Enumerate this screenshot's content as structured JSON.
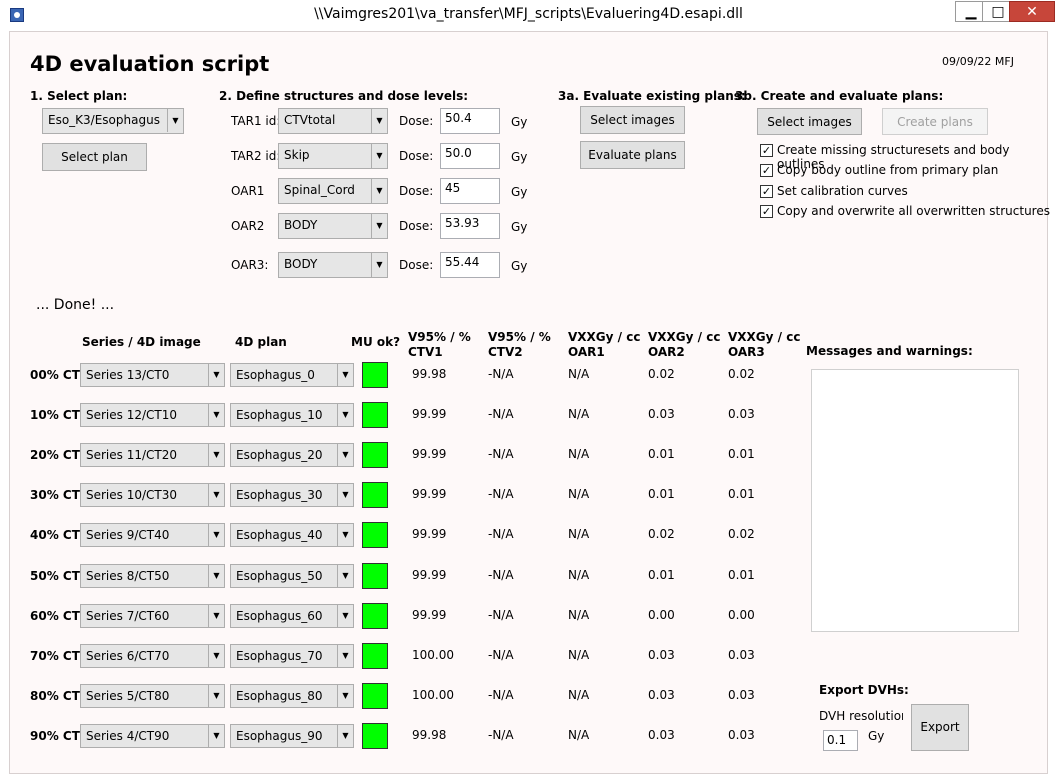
{
  "window": {
    "title": "\\\\Vaimgres201\\va_transfer\\MFJ_scripts\\Evaluering4D.esapi.dll",
    "minimize": "▁",
    "maximize": "□",
    "close": "✕"
  },
  "header": {
    "title": "4D evaluation script",
    "version_date": "09/09/22 MFJ"
  },
  "step1": {
    "heading": "1. Select plan:",
    "plan_value": "Eso_K3/Esophagus",
    "select_button": "Select plan"
  },
  "step2": {
    "heading": "2. Define structures and dose levels:",
    "dose_label": "Dose:",
    "unit": "Gy",
    "rows": [
      {
        "label": "TAR1 id:",
        "structure": "CTVtotal",
        "dose": "50.4"
      },
      {
        "label": "TAR2 id:",
        "structure": "Skip",
        "dose": "50.0"
      },
      {
        "label": "OAR1",
        "structure": "Spinal_Cord",
        "dose": "45"
      },
      {
        "label": "OAR2",
        "structure": "BODY",
        "dose": "53.93"
      },
      {
        "label": "OAR3:",
        "structure": "BODY",
        "dose": "55.44"
      }
    ]
  },
  "step3a": {
    "heading": "3a. Evaluate existing plans:",
    "select_images": "Select images",
    "evaluate_plans": "Evaluate plans"
  },
  "step3b": {
    "heading": "3b. Create and evaluate plans:",
    "select_images": "Select images",
    "create_plans": "Create plans",
    "options": [
      {
        "label": "Create missing structuresets and body outlines",
        "checked": true
      },
      {
        "label": "Copy body outline from primary plan",
        "checked": true
      },
      {
        "label": "Set calibration curves",
        "checked": true
      },
      {
        "label": "Copy and overwrite all overwritten structures",
        "checked": true
      }
    ]
  },
  "status": "... Done! ...",
  "table": {
    "headers": {
      "series": "Series / 4D image",
      "plan": "4D plan",
      "mu": "MU ok?",
      "v1": "V95% / %",
      "v1b": "CTV1",
      "v2": "V95% / %",
      "v2b": "CTV2",
      "o1": "VXXGy / cc",
      "o1b": "OAR1",
      "o2": "VXXGy / cc",
      "o2b": "OAR2",
      "o3": "VXXGy / cc",
      "o3b": "OAR3"
    },
    "rows": [
      {
        "phase": "00% CT",
        "series": "Series 13/CT0",
        "plan": "Esophagus_0",
        "ctv1": "99.98",
        "ctv2": "-N/A",
        "oar1": "N/A",
        "oar2": "0.02",
        "oar3": "0.02"
      },
      {
        "phase": "10% CT",
        "series": "Series 12/CT10",
        "plan": "Esophagus_10",
        "ctv1": "99.99",
        "ctv2": "-N/A",
        "oar1": "N/A",
        "oar2": "0.03",
        "oar3": "0.03"
      },
      {
        "phase": "20% CT",
        "series": "Series 11/CT20",
        "plan": "Esophagus_20",
        "ctv1": "99.99",
        "ctv2": "-N/A",
        "oar1": "N/A",
        "oar2": "0.01",
        "oar3": "0.01"
      },
      {
        "phase": "30% CT",
        "series": "Series 10/CT30",
        "plan": "Esophagus_30",
        "ctv1": "99.99",
        "ctv2": "-N/A",
        "oar1": "N/A",
        "oar2": "0.01",
        "oar3": "0.01"
      },
      {
        "phase": "40% CT",
        "series": "Series 9/CT40",
        "plan": "Esophagus_40",
        "ctv1": "99.99",
        "ctv2": "-N/A",
        "oar1": "N/A",
        "oar2": "0.02",
        "oar3": "0.02"
      },
      {
        "phase": "50% CT",
        "series": "Series 8/CT50",
        "plan": "Esophagus_50",
        "ctv1": "99.99",
        "ctv2": "-N/A",
        "oar1": "N/A",
        "oar2": "0.01",
        "oar3": "0.01"
      },
      {
        "phase": "60% CT",
        "series": "Series 7/CT60",
        "plan": "Esophagus_60",
        "ctv1": "99.99",
        "ctv2": "-N/A",
        "oar1": "N/A",
        "oar2": "0.00",
        "oar3": "0.00"
      },
      {
        "phase": "70% CT",
        "series": "Series 6/CT70",
        "plan": "Esophagus_70",
        "ctv1": "100.00",
        "ctv2": "-N/A",
        "oar1": "N/A",
        "oar2": "0.03",
        "oar3": "0.03"
      },
      {
        "phase": "80% CT",
        "series": "Series 5/CT80",
        "plan": "Esophagus_80",
        "ctv1": "100.00",
        "ctv2": "-N/A",
        "oar1": "N/A",
        "oar2": "0.03",
        "oar3": "0.03"
      },
      {
        "phase": "90% CT",
        "series": "Series 4/CT90",
        "plan": "Esophagus_90",
        "ctv1": "99.98",
        "ctv2": "-N/A",
        "oar1": "N/A",
        "oar2": "0.03",
        "oar3": "0.03"
      }
    ]
  },
  "messages": {
    "heading": "Messages and warnings:"
  },
  "export": {
    "heading": "Export DVHs:",
    "resolution_label": "DVH resolution:",
    "resolution_value": "0.1",
    "unit": "Gy",
    "button": "Export"
  },
  "colors": {
    "mu_ok": "#00ff00",
    "close_button": "#c7463a",
    "background": "#fef9f9"
  }
}
